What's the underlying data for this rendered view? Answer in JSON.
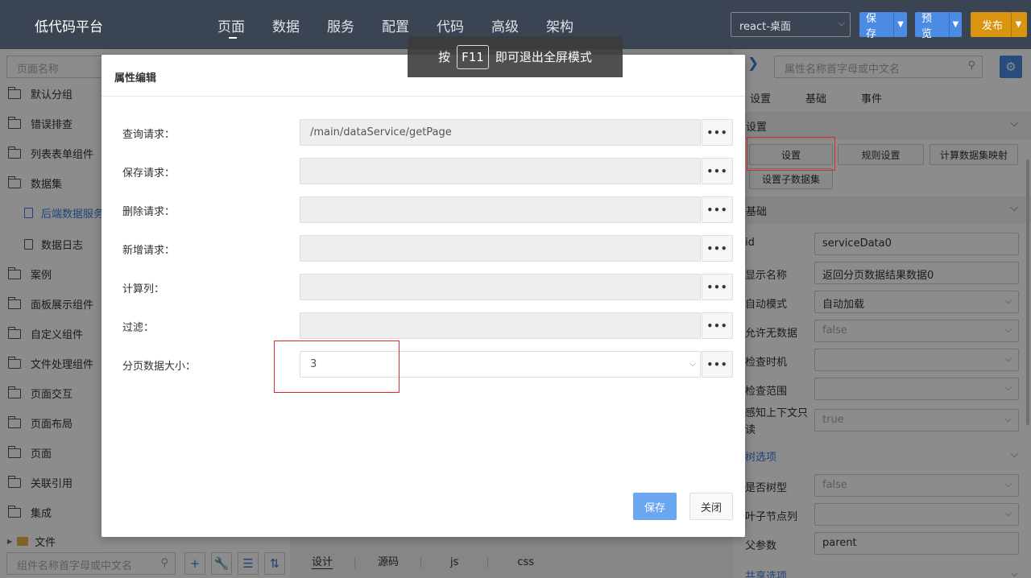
{
  "app": {
    "title": "低代码平台"
  },
  "nav": {
    "items": [
      {
        "label": "页面",
        "active": true
      },
      {
        "label": "数据"
      },
      {
        "label": "服务"
      },
      {
        "label": "配置"
      },
      {
        "label": "代码"
      },
      {
        "label": "高级"
      },
      {
        "label": "架构"
      }
    ]
  },
  "toolbar": {
    "project": "react-桌面",
    "save": "保存",
    "preview": "预览",
    "publish": "发布"
  },
  "left": {
    "search_placeholder": "页面名称",
    "tree": [
      {
        "label": "默认分组",
        "type": "folder"
      },
      {
        "label": "错误排查",
        "type": "folder"
      },
      {
        "label": "列表表单组件",
        "type": "folder"
      },
      {
        "label": "数据集",
        "type": "folder"
      },
      {
        "label": "后端数据服务",
        "type": "doc",
        "selected": true
      },
      {
        "label": "数据日志",
        "type": "doc"
      },
      {
        "label": "案例",
        "type": "folder"
      },
      {
        "label": "面板展示组件",
        "type": "folder"
      },
      {
        "label": "自定义组件",
        "type": "folder"
      },
      {
        "label": "文件处理组件",
        "type": "folder"
      },
      {
        "label": "页面交互",
        "type": "folder"
      },
      {
        "label": "页面布局",
        "type": "folder"
      },
      {
        "label": "页面",
        "type": "folder"
      },
      {
        "label": "关联引用",
        "type": "folder"
      },
      {
        "label": "集成",
        "type": "folder"
      }
    ],
    "file_label": "文件",
    "component_search_placeholder": "组件名称首字母或中文名"
  },
  "center": {
    "bottom_tabs": [
      "设计",
      "源码",
      "js",
      "css"
    ]
  },
  "right": {
    "search_placeholder": "属性名称首字母或中文名",
    "tabs": [
      "设置",
      "基础",
      "事件"
    ],
    "section_settings": "设置",
    "buttons": [
      "设置",
      "规则设置",
      "计算数据集映射",
      "设置子数据集"
    ],
    "section_basic": "基础",
    "fields": [
      {
        "label": "id",
        "value": "serviceData0"
      },
      {
        "label": "显示名称",
        "value": "返回分页数据结果数据0"
      },
      {
        "label": "自动模式",
        "value": "自动加载"
      },
      {
        "label": "允许无数据",
        "value": "false"
      },
      {
        "label": "检查时机",
        "value": ""
      },
      {
        "label": "检查范围",
        "value": ""
      },
      {
        "label": "感知上下文只读",
        "value": "true"
      }
    ],
    "tree_options": "树选项",
    "tree_fields": [
      {
        "label": "是否树型",
        "value": "false"
      },
      {
        "label": "叶子节点列",
        "value": ""
      },
      {
        "label": "父参数",
        "value": "parent"
      }
    ],
    "shared_options": "共享选项"
  },
  "modal": {
    "title": "属性编辑",
    "rows": [
      {
        "label": "查询请求：",
        "value": "/main/dataService/getPage"
      },
      {
        "label": "保存请求：",
        "value": ""
      },
      {
        "label": "删除请求：",
        "value": ""
      },
      {
        "label": "新增请求：",
        "value": ""
      },
      {
        "label": "计算列：",
        "value": ""
      },
      {
        "label": "过滤：",
        "value": ""
      },
      {
        "label": "分页数据大小：",
        "value": "3"
      }
    ],
    "save": "保存",
    "close": "关闭"
  },
  "toast": {
    "before": "按",
    "key": "F11",
    "after": "即可退出全屏模式"
  }
}
